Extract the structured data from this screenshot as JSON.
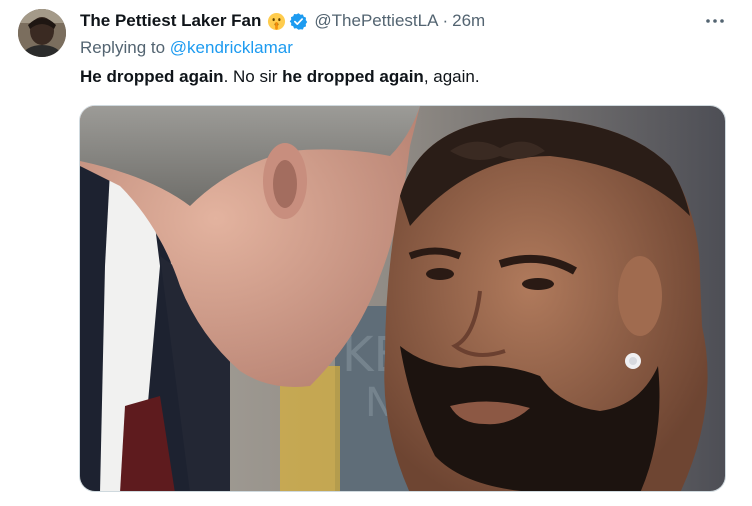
{
  "author": {
    "display_name": "The Pettiest Laker Fan",
    "handle": "@ThePettiestLA",
    "separator": "·",
    "time": "26m",
    "emoji_icon": "shushing-face-emoji-icon",
    "verified_icon": "verified-badge-icon"
  },
  "reply": {
    "prefix": "Replying to",
    "mention": "@kendricklamar"
  },
  "tweet_text": {
    "part1": "He dropped again",
    "part2": ". No sir ",
    "part3": "he dropped again",
    "part4": ", again."
  },
  "more_icon": "ellipsis-icon",
  "colors": {
    "link": "#1d9bf0",
    "secondary": "#536471",
    "verified": "#1d9bf0",
    "text": "#0f1419"
  }
}
